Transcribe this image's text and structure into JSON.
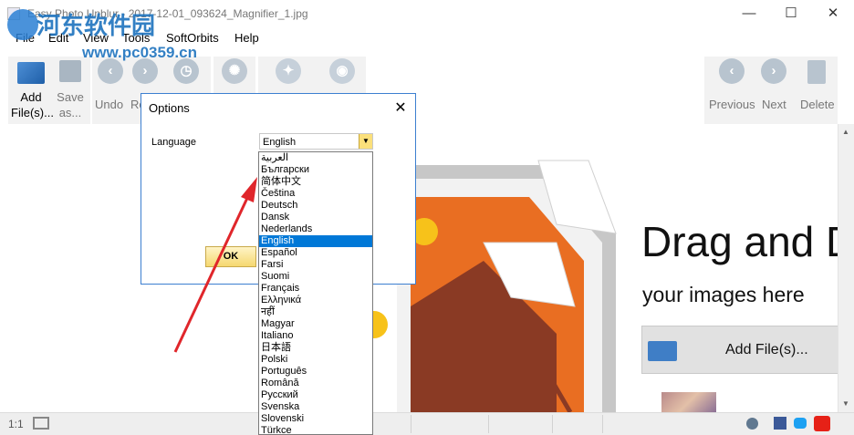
{
  "window": {
    "title": "Easy Photo Unblur - 2017-12-01_093624_Magnifier_1.jpg",
    "controls": {
      "minimize": "—",
      "maximize": "☐",
      "close": "✕"
    }
  },
  "watermark": {
    "site_name": "河东软件园",
    "url": "www.pc0359.cn"
  },
  "menu": [
    "File",
    "Edit",
    "View",
    "Tools",
    "SoftOrbits",
    "Help"
  ],
  "toolbar": {
    "add_files": [
      "Add",
      "File(s)..."
    ],
    "save_as": [
      "Save",
      "as..."
    ],
    "undo": "Undo",
    "redo": "Re",
    "previous": "Previous",
    "next": "Next",
    "delete": "Delete"
  },
  "canvas": {
    "drag_title": "Drag and D",
    "drag_subtitle": "your images here",
    "add_files_button": "Add File(s)..."
  },
  "statusbar": {
    "zoom": "1:1"
  },
  "dialog": {
    "title": "Options",
    "close": "✕",
    "language_label": "Language",
    "selected_language": "English",
    "ok_label": "OK"
  },
  "languages": [
    "العربية",
    "Български",
    "简体中文",
    "Čeština",
    "Deutsch",
    "Dansk",
    "Nederlands",
    "English",
    "Español",
    "Farsi",
    "Suomi",
    "Français",
    "Ελληνικά",
    "नहीं",
    "Magyar",
    "Italiano",
    "日本語",
    "Polski",
    "Português",
    "Română",
    "Русский",
    "Svenska",
    "Slovenski",
    "Türkce"
  ],
  "colors": {
    "accent": "#0078d7",
    "annotation_arrow": "#e0262b",
    "image_orange": "#e96e22"
  }
}
